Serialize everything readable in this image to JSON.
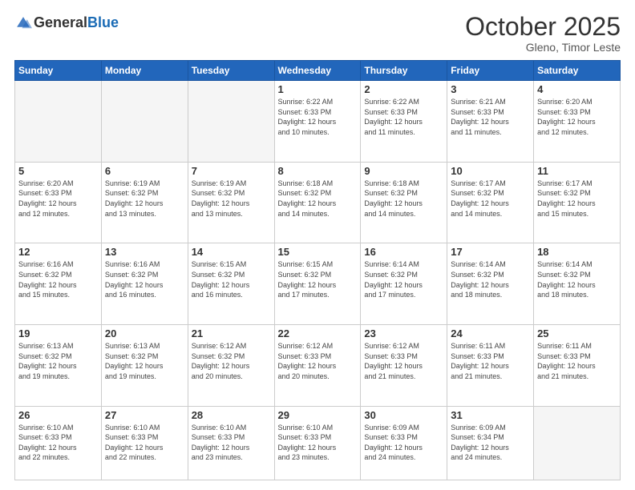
{
  "header": {
    "logo_general": "General",
    "logo_blue": "Blue",
    "month_title": "October 2025",
    "location": "Gleno, Timor Leste"
  },
  "days_of_week": [
    "Sunday",
    "Monday",
    "Tuesday",
    "Wednesday",
    "Thursday",
    "Friday",
    "Saturday"
  ],
  "weeks": [
    [
      {
        "day": "",
        "info": ""
      },
      {
        "day": "",
        "info": ""
      },
      {
        "day": "",
        "info": ""
      },
      {
        "day": "1",
        "info": "Sunrise: 6:22 AM\nSunset: 6:33 PM\nDaylight: 12 hours\nand 10 minutes."
      },
      {
        "day": "2",
        "info": "Sunrise: 6:22 AM\nSunset: 6:33 PM\nDaylight: 12 hours\nand 11 minutes."
      },
      {
        "day": "3",
        "info": "Sunrise: 6:21 AM\nSunset: 6:33 PM\nDaylight: 12 hours\nand 11 minutes."
      },
      {
        "day": "4",
        "info": "Sunrise: 6:20 AM\nSunset: 6:33 PM\nDaylight: 12 hours\nand 12 minutes."
      }
    ],
    [
      {
        "day": "5",
        "info": "Sunrise: 6:20 AM\nSunset: 6:33 PM\nDaylight: 12 hours\nand 12 minutes."
      },
      {
        "day": "6",
        "info": "Sunrise: 6:19 AM\nSunset: 6:32 PM\nDaylight: 12 hours\nand 13 minutes."
      },
      {
        "day": "7",
        "info": "Sunrise: 6:19 AM\nSunset: 6:32 PM\nDaylight: 12 hours\nand 13 minutes."
      },
      {
        "day": "8",
        "info": "Sunrise: 6:18 AM\nSunset: 6:32 PM\nDaylight: 12 hours\nand 14 minutes."
      },
      {
        "day": "9",
        "info": "Sunrise: 6:18 AM\nSunset: 6:32 PM\nDaylight: 12 hours\nand 14 minutes."
      },
      {
        "day": "10",
        "info": "Sunrise: 6:17 AM\nSunset: 6:32 PM\nDaylight: 12 hours\nand 14 minutes."
      },
      {
        "day": "11",
        "info": "Sunrise: 6:17 AM\nSunset: 6:32 PM\nDaylight: 12 hours\nand 15 minutes."
      }
    ],
    [
      {
        "day": "12",
        "info": "Sunrise: 6:16 AM\nSunset: 6:32 PM\nDaylight: 12 hours\nand 15 minutes."
      },
      {
        "day": "13",
        "info": "Sunrise: 6:16 AM\nSunset: 6:32 PM\nDaylight: 12 hours\nand 16 minutes."
      },
      {
        "day": "14",
        "info": "Sunrise: 6:15 AM\nSunset: 6:32 PM\nDaylight: 12 hours\nand 16 minutes."
      },
      {
        "day": "15",
        "info": "Sunrise: 6:15 AM\nSunset: 6:32 PM\nDaylight: 12 hours\nand 17 minutes."
      },
      {
        "day": "16",
        "info": "Sunrise: 6:14 AM\nSunset: 6:32 PM\nDaylight: 12 hours\nand 17 minutes."
      },
      {
        "day": "17",
        "info": "Sunrise: 6:14 AM\nSunset: 6:32 PM\nDaylight: 12 hours\nand 18 minutes."
      },
      {
        "day": "18",
        "info": "Sunrise: 6:14 AM\nSunset: 6:32 PM\nDaylight: 12 hours\nand 18 minutes."
      }
    ],
    [
      {
        "day": "19",
        "info": "Sunrise: 6:13 AM\nSunset: 6:32 PM\nDaylight: 12 hours\nand 19 minutes."
      },
      {
        "day": "20",
        "info": "Sunrise: 6:13 AM\nSunset: 6:32 PM\nDaylight: 12 hours\nand 19 minutes."
      },
      {
        "day": "21",
        "info": "Sunrise: 6:12 AM\nSunset: 6:32 PM\nDaylight: 12 hours\nand 20 minutes."
      },
      {
        "day": "22",
        "info": "Sunrise: 6:12 AM\nSunset: 6:33 PM\nDaylight: 12 hours\nand 20 minutes."
      },
      {
        "day": "23",
        "info": "Sunrise: 6:12 AM\nSunset: 6:33 PM\nDaylight: 12 hours\nand 21 minutes."
      },
      {
        "day": "24",
        "info": "Sunrise: 6:11 AM\nSunset: 6:33 PM\nDaylight: 12 hours\nand 21 minutes."
      },
      {
        "day": "25",
        "info": "Sunrise: 6:11 AM\nSunset: 6:33 PM\nDaylight: 12 hours\nand 21 minutes."
      }
    ],
    [
      {
        "day": "26",
        "info": "Sunrise: 6:10 AM\nSunset: 6:33 PM\nDaylight: 12 hours\nand 22 minutes."
      },
      {
        "day": "27",
        "info": "Sunrise: 6:10 AM\nSunset: 6:33 PM\nDaylight: 12 hours\nand 22 minutes."
      },
      {
        "day": "28",
        "info": "Sunrise: 6:10 AM\nSunset: 6:33 PM\nDaylight: 12 hours\nand 23 minutes."
      },
      {
        "day": "29",
        "info": "Sunrise: 6:10 AM\nSunset: 6:33 PM\nDaylight: 12 hours\nand 23 minutes."
      },
      {
        "day": "30",
        "info": "Sunrise: 6:09 AM\nSunset: 6:33 PM\nDaylight: 12 hours\nand 24 minutes."
      },
      {
        "day": "31",
        "info": "Sunrise: 6:09 AM\nSunset: 6:34 PM\nDaylight: 12 hours\nand 24 minutes."
      },
      {
        "day": "",
        "info": ""
      }
    ]
  ]
}
